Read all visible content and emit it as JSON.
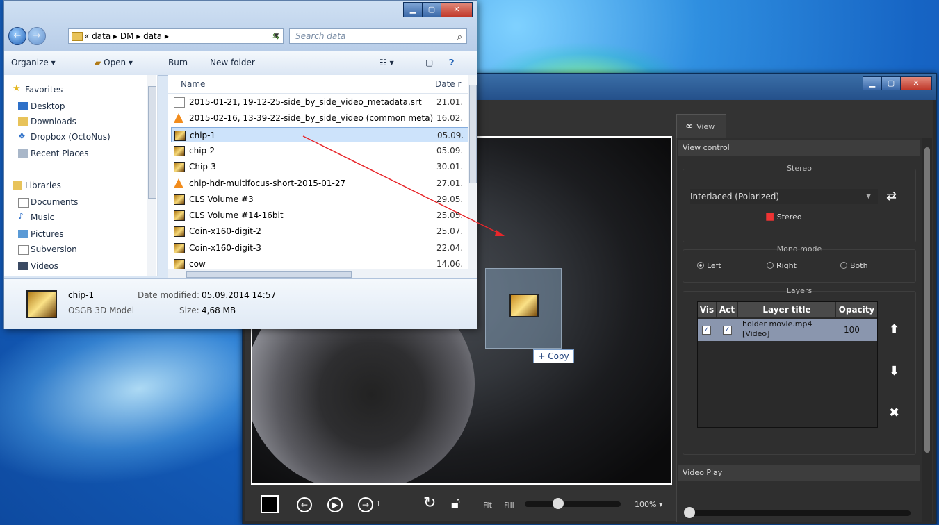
{
  "explorer": {
    "breadcrumb": "« data ▸ DM ▸ data ▸",
    "search_placeholder": "Search data",
    "toolbar": {
      "organize": "Organize ▾",
      "open": "Open ▾",
      "burn": "Burn",
      "new_folder": "New folder"
    },
    "nav": {
      "favorites": "Favorites",
      "desktop": "Desktop",
      "downloads": "Downloads",
      "dropbox": "Dropbox (OctoNus)",
      "recent_places": "Recent Places",
      "libraries": "Libraries",
      "documents": "Documents",
      "music": "Music",
      "pictures": "Pictures",
      "subversion": "Subversion",
      "videos": "Videos"
    },
    "columns": {
      "name": "Name",
      "date": "Date r"
    },
    "files": [
      {
        "name": "2015-01-21, 19-12-25-side_by_side_video_metadata.srt",
        "date": "21.01.",
        "icon": "document-icon"
      },
      {
        "name": "2015-02-16, 13-39-22-side_by_side_video (common meta)",
        "date": "16.02.",
        "icon": "vlc-icon"
      },
      {
        "name": "chip-1",
        "date": "05.09.",
        "icon": "osgb-model-icon"
      },
      {
        "name": "chip-2",
        "date": "05.09.",
        "icon": "osgb-model-icon"
      },
      {
        "name": "Chip-3",
        "date": "30.01.",
        "icon": "osgb-model-icon"
      },
      {
        "name": "chip-hdr-multifocus-short-2015-01-27",
        "date": "27.01.",
        "icon": "vlc-icon"
      },
      {
        "name": "CLS Volume #3",
        "date": "29.05.",
        "icon": "osgb-model-icon"
      },
      {
        "name": "CLS Volume #14-16bit",
        "date": "25.05.",
        "icon": "osgb-model-icon"
      },
      {
        "name": "Coin-x160-digit-2",
        "date": "25.07.",
        "icon": "osgb-model-icon"
      },
      {
        "name": "Coin-x160-digit-3",
        "date": "22.04.",
        "icon": "osgb-model-icon"
      },
      {
        "name": "cow",
        "date": "14.06.",
        "icon": "osgb-model-icon"
      }
    ],
    "details": {
      "name": "chip-1",
      "type": "OSGB 3D Model",
      "modified_label": "Date modified:",
      "modified": "05.09.2014 14:57",
      "size_label": "Size:",
      "size": "4,68 MB"
    }
  },
  "drag": {
    "copy_tip": "+ Copy"
  },
  "viewer": {
    "frame_number": "1",
    "fit": "Fit",
    "fill": "Fill",
    "zoom": "100% ▾",
    "tab_view": "View",
    "view_control": "View control",
    "stereo_group": "Stereo",
    "stereo_mode": "Interlaced (Polarized)",
    "stereo_button": "Stereo",
    "mono_group": "Mono mode",
    "mono_left": "Left",
    "mono_right": "Right",
    "mono_both": "Both",
    "mono_selected": "Left",
    "layers_group": "Layers",
    "layers_cols": {
      "vis": "Vis",
      "act": "Act",
      "title": "Layer title",
      "opacity": "Opacity"
    },
    "layer": {
      "title": "holder movie.mp4 [Video]",
      "opacity": "100",
      "vis": true,
      "act": true
    },
    "video_play": "Video Play"
  }
}
